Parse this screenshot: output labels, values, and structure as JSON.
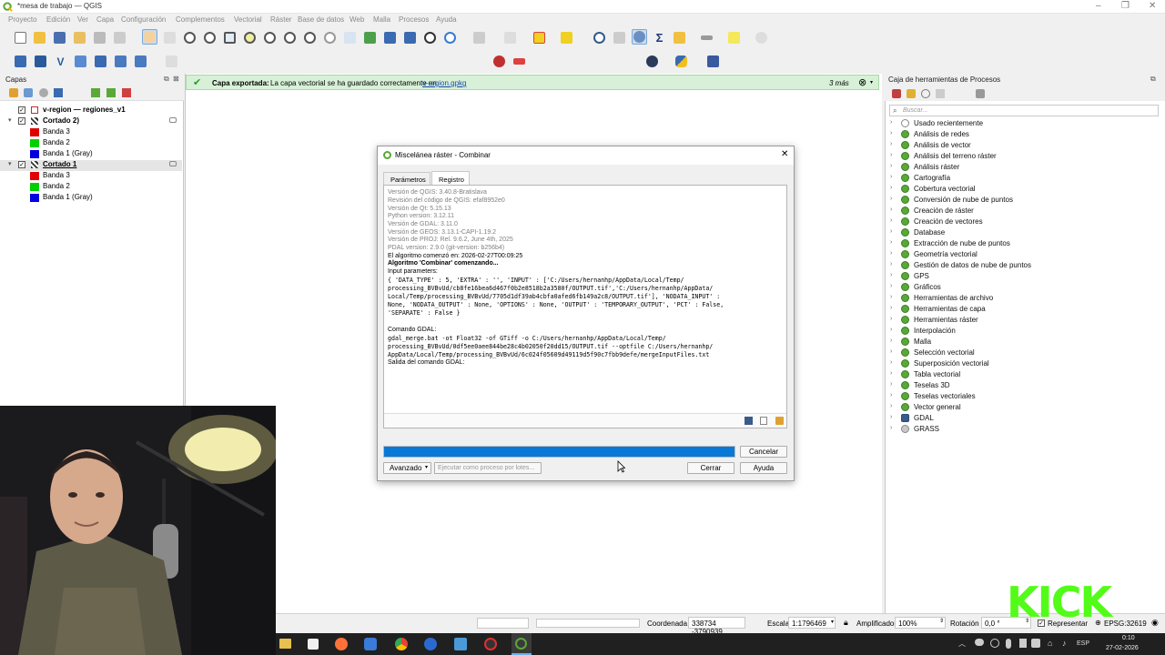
{
  "window": {
    "title": "*mesa de trabajo — QGIS"
  },
  "menu": [
    "Proyecto",
    "Edición",
    "Ver",
    "Capa",
    "Configuración",
    "Complementos",
    "Vectorial",
    "Ráster",
    "Base de datos",
    "Web",
    "Malla",
    "Procesos",
    "Ayuda"
  ],
  "layers_panel": {
    "title": "Capas",
    "items": [
      {
        "label": "v-region — regiones_v1",
        "checked": true,
        "level": 0
      },
      {
        "label": "Cortado 2)",
        "checked": true,
        "level": 0
      },
      {
        "label": "Banda 3",
        "color": "#e00000",
        "level": 1
      },
      {
        "label": "Banda 2",
        "color": "#00d000",
        "level": 1
      },
      {
        "label": "Banda 1 (Gray)",
        "color": "#0000e0",
        "level": 1
      },
      {
        "label": "Cortado 1",
        "checked": true,
        "level": 0
      },
      {
        "label": "Banda 3",
        "color": "#e00000",
        "level": 1
      },
      {
        "label": "Banda 2",
        "color": "#00d000",
        "level": 1
      },
      {
        "label": "Banda 1 (Gray)",
        "color": "#0000e0",
        "level": 1
      }
    ]
  },
  "message_bar": {
    "title": "Capa exportada:",
    "text": "La capa vectorial se ha guardado correctamente en",
    "link": "v-region.gpkg",
    "more": "3 más"
  },
  "dialog": {
    "title": "Miscelánea ráster - Combinar",
    "tabs": [
      "Parámetros",
      "Registro"
    ],
    "log": [
      "Versión de QGIS: 3.40.8-Bratislava",
      "Revisión del código de QGIS: efaf8952e0",
      "Versión de Qt: 5.15.13",
      "Python version: 3.12.11",
      "Versión de GDAL: 3.11.0",
      "Versión de GEOS: 3.13.1-CAPI-1.19.2",
      "Versión de PROJ: Rel. 9.6.2, June 4th, 2025",
      "PDAL version: 2.9.0 (git-version: b256b4)",
      "El algoritmo comenzó en: 2026-02-27T00:09:25",
      "Algoritmo 'Combinar' comenzando...",
      "Input parameters:"
    ],
    "params_lines": [
      "{ 'DATA_TYPE' : 5, 'EXTRA' : '', 'INPUT' : ['C:/Users/hernanhp/AppData/Local/Temp/",
      "processing_BVBvUd/cb8fe16bea6d467f0b2e8518b2a3580f/OUTPUT.tif','C:/Users/hernanhp/AppData/",
      "Local/Temp/processing_BVBvUd/7705d1df39ab4cbfa0afed6fb149a2c8/OUTPUT.tif'], 'NODATA_INPUT' :",
      "None, 'NODATA_OUTPUT' : None, 'OPTIONS' : None, 'OUTPUT' : 'TEMPORARY_OUTPUT', 'PCT' : False,",
      "'SEPARATE' : False }"
    ],
    "gdal_title": "Comando GDAL:",
    "gdal_lines": [
      "gdal_merge.bat -ot Float32 -of GTiff -o C:/Users/hernanhp/AppData/Local/Temp/",
      "processing_BVBvUd/0df5ee0aee844be28c4b02050f20dd15/OUTPUT.tif --optfile C:/Users/hernanhp/",
      "AppData/Local/Temp/processing_BVBvUd/6c024f05609d49119d5f90c7fbb9defe/mergeInputFiles.txt"
    ],
    "output_title": "Salida del comando GDAL:",
    "progress": 1.0,
    "buttons": {
      "cancel": "Cancelar",
      "advanced": "Avanzado",
      "batch": "Ejecutar como proceso por lotes...",
      "close": "Cerrar",
      "help": "Ayuda"
    }
  },
  "toolbox": {
    "title": "Caja de herramientas de Procesos",
    "search_placeholder": "Buscar...",
    "items": [
      "Usado recientemente",
      "Análisis de redes",
      "Análisis de vector",
      "Análisis del terreno ráster",
      "Análisis ráster",
      "Cartografía",
      "Cobertura vectorial",
      "Conversión de nube de puntos",
      "Creación de ráster",
      "Creación de vectores",
      "Database",
      "Extracción de nube de puntos",
      "Geometría vectorial",
      "Gestión de datos de nube de puntos",
      "GPS",
      "Gráficos",
      "Herramientas de archivo",
      "Herramientas de capa",
      "Herramientas ráster",
      "Interpolación",
      "Malla",
      "Selección vectorial",
      "Superposición vectorial",
      "Tabla vectorial",
      "Teselas 3D",
      "Teselas vectoriales",
      "Vector general",
      "GDAL",
      "GRASS"
    ]
  },
  "status": {
    "coord_label": "Coordenada",
    "coord_value": "338734 -3790939",
    "scale_label": "Escala",
    "scale_value": "1:1796469",
    "magnifier_label": "Amplificador",
    "magnifier_value": "100%",
    "rotation_label": "Rotación",
    "rotation_value": "0,0 °",
    "render_label": "Representar",
    "epsg": "EPSG:32619"
  },
  "taskbar": {
    "lang": "ESP",
    "time": "0:10",
    "date": "27-02-2026"
  },
  "overlay": {
    "kick": "KICK"
  }
}
